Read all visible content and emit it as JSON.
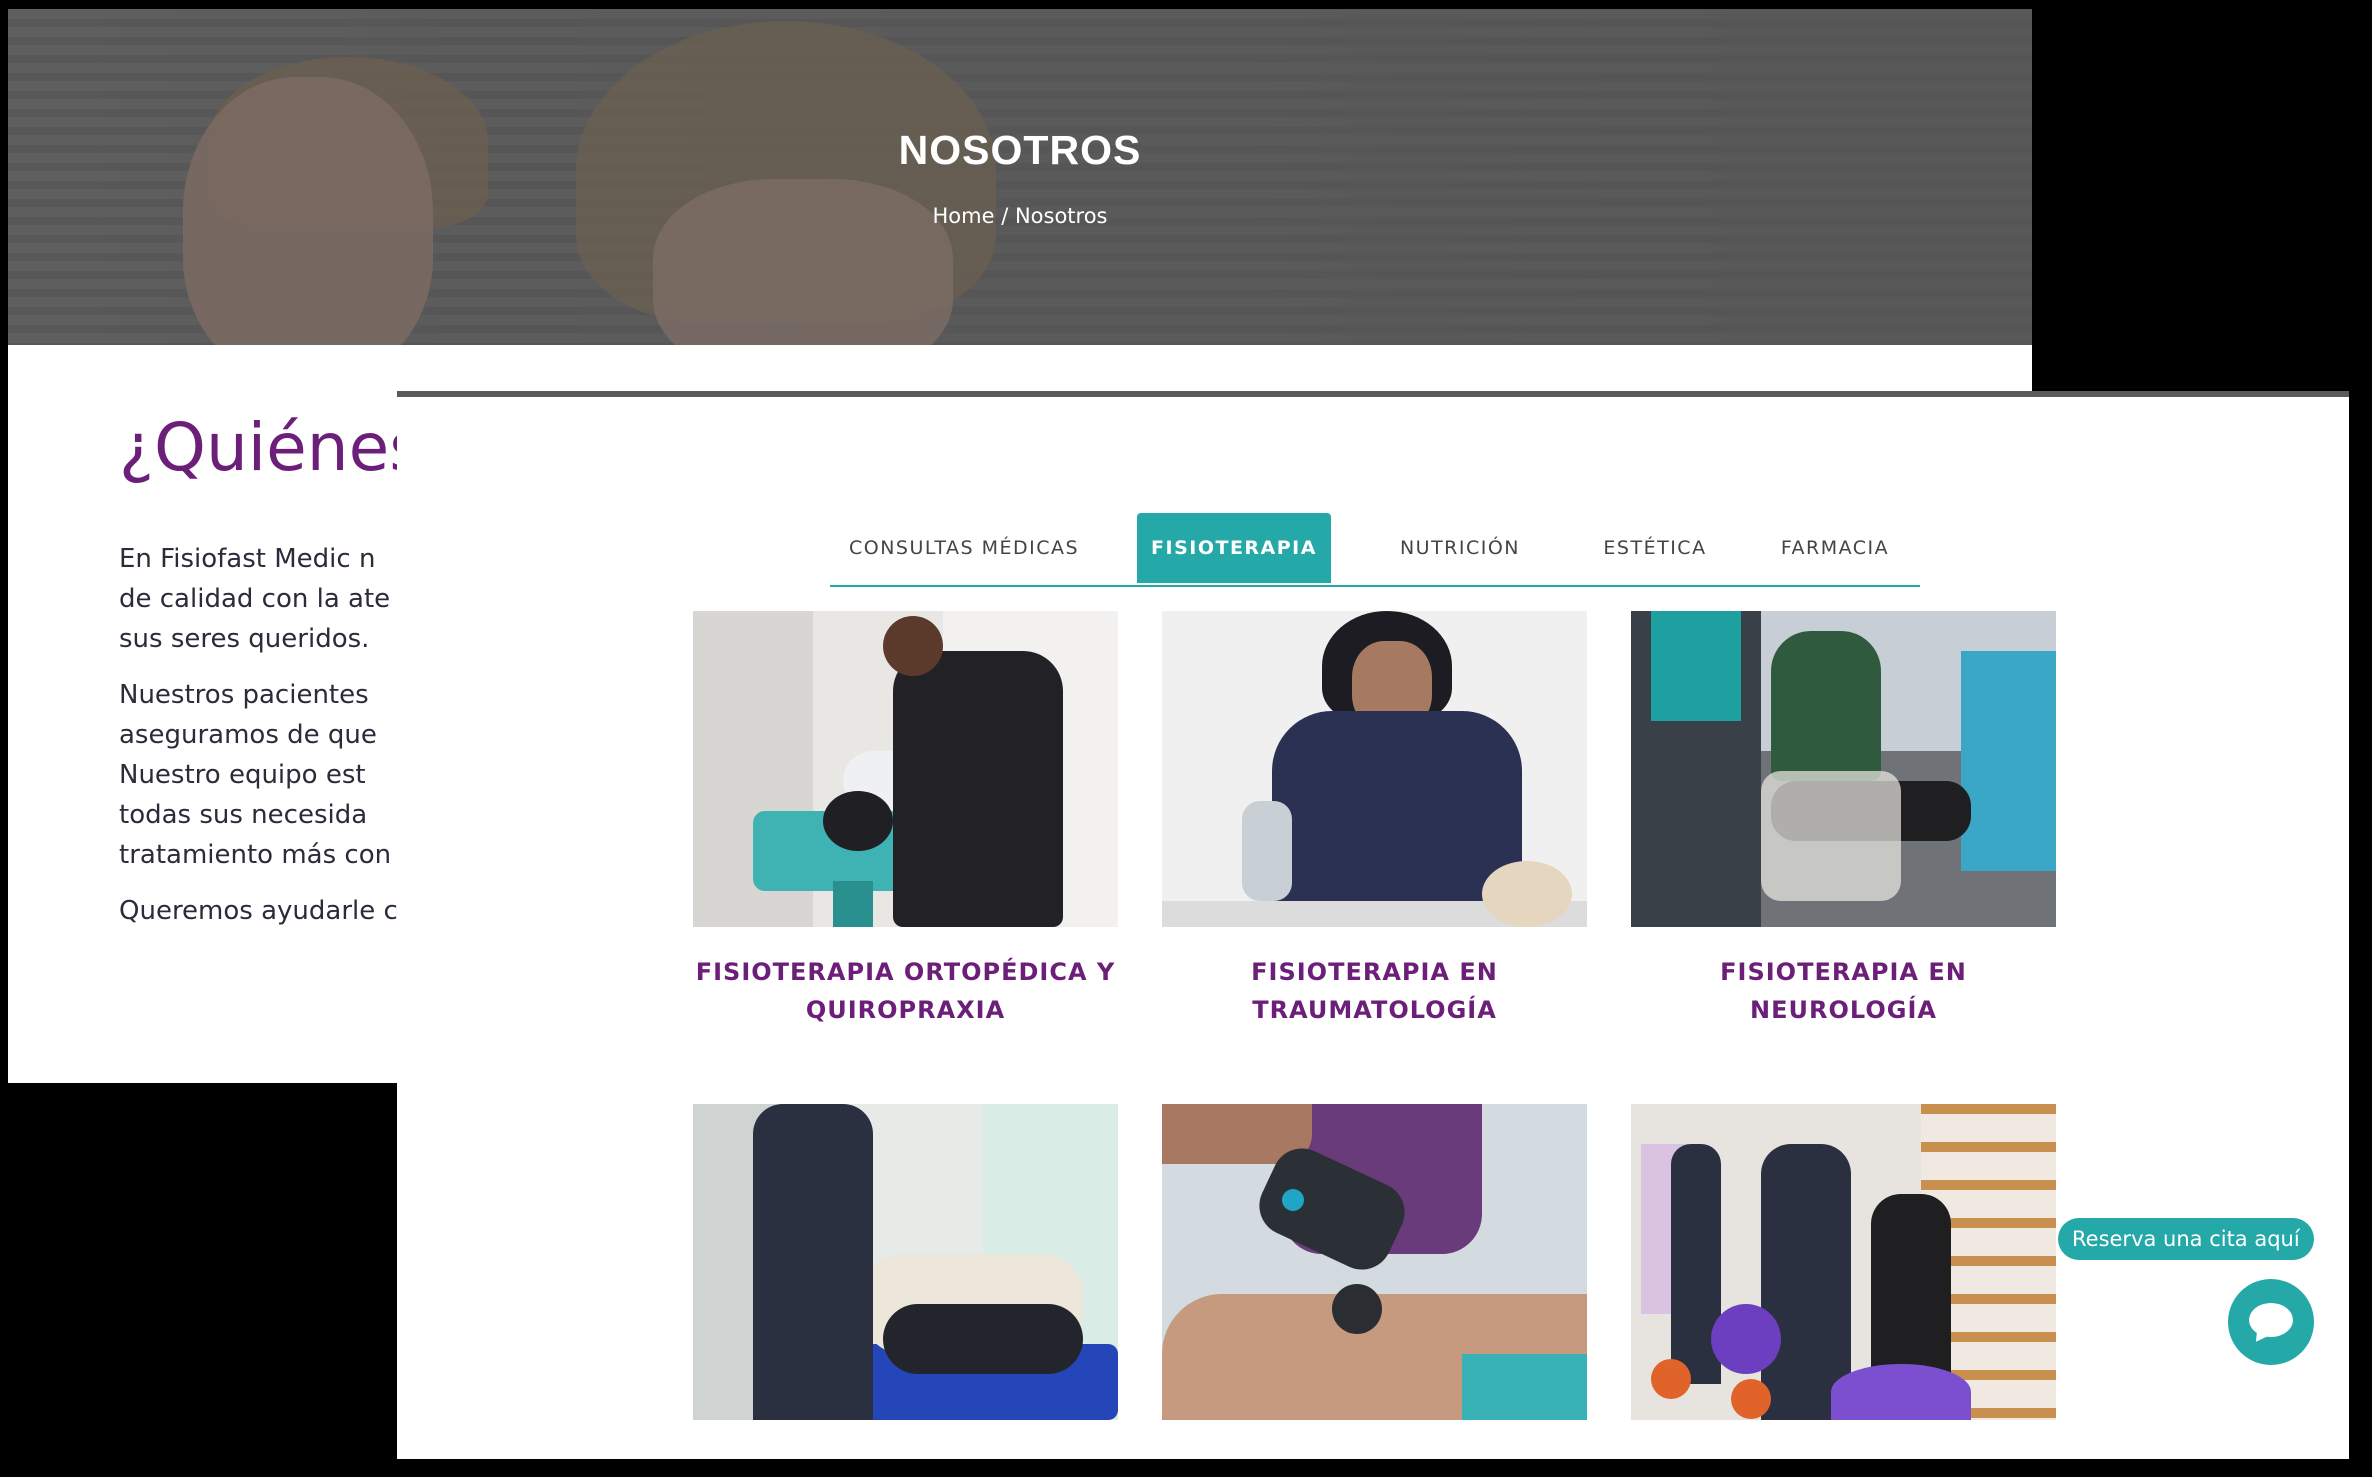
{
  "hero": {
    "title": "NOSOTROS",
    "breadcrumb": "Home / Nosotros"
  },
  "about": {
    "heading": "¿Quiénes",
    "paragraphs": [
      [
        "En Fisiofast Medic n",
        "de calidad con la ate",
        "sus seres queridos."
      ],
      [
        "Nuestros pacientes",
        "aseguramos de que",
        "Nuestro equipo est",
        "todas sus necesida",
        "tratamiento más con"
      ],
      [
        "Queremos ayudarle c"
      ]
    ]
  },
  "tabs": [
    {
      "label": "CONSULTAS MÉDICAS",
      "active": false
    },
    {
      "label": "FISIOTERAPIA",
      "active": true
    },
    {
      "label": "NUTRICIÓN",
      "active": false
    },
    {
      "label": "ESTÉTICA",
      "active": false
    },
    {
      "label": "FARMACIA",
      "active": false
    }
  ],
  "services": [
    {
      "title": "FISIOTERAPIA ORTOPÉDICA Y QUIROPRAXIA"
    },
    {
      "title": "FISIOTERAPIA EN TRAUMATOLOGÍA"
    },
    {
      "title": "FISIOTERAPIA EN NEUROLOGÍA"
    },
    {
      "title": ""
    },
    {
      "title": ""
    },
    {
      "title": ""
    }
  ],
  "booking": {
    "reserve_label": "Reserva una cita aquí"
  },
  "colors": {
    "accent_teal": "#24a8a8",
    "brand_purple": "#6b1f78"
  },
  "icons": {
    "chat": "chat-bubble-icon"
  }
}
